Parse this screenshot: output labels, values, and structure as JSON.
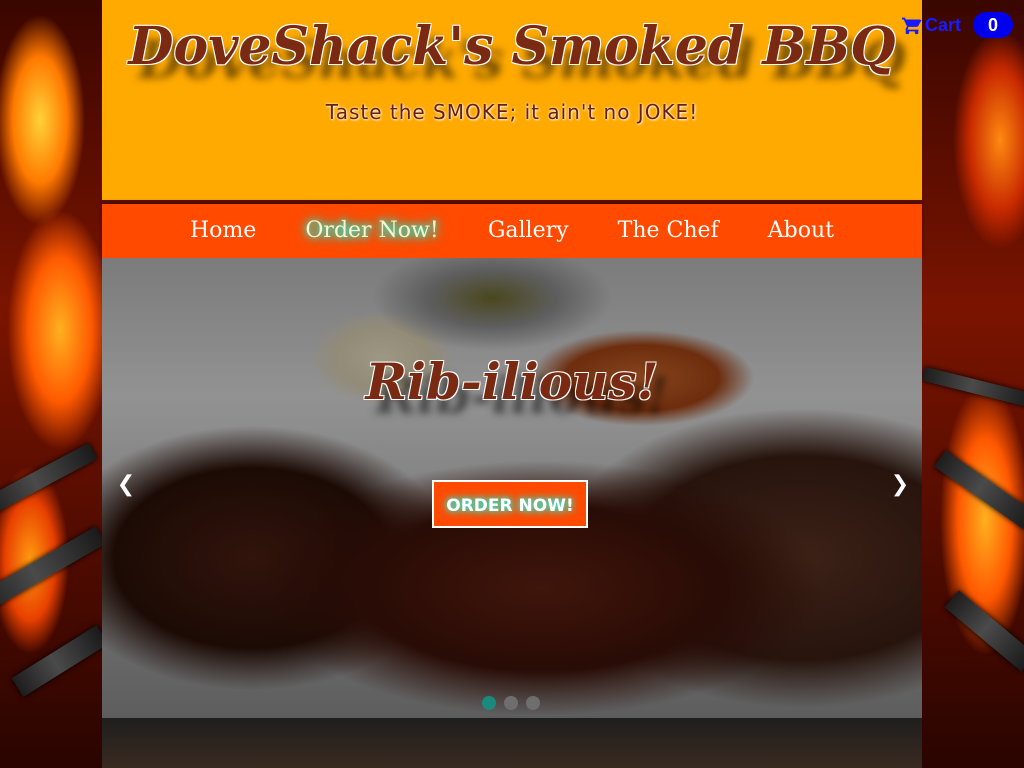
{
  "header": {
    "title": "DoveShack's Smoked BBQ",
    "tagline": "Taste the SMOKE; it ain't no JOKE!"
  },
  "nav": {
    "items": [
      {
        "label": "Home"
      },
      {
        "label": "Order Now!",
        "active": true
      },
      {
        "label": "Gallery"
      },
      {
        "label": "The Chef"
      },
      {
        "label": "About"
      }
    ]
  },
  "hero": {
    "heading": "Rib-ilious!",
    "cta_label": "ORDER NOW!",
    "prev_arrow": "❮",
    "next_arrow": "❯",
    "slide_count": 3,
    "active_slide": 1
  },
  "cart": {
    "label": "Cart",
    "count": "0",
    "icon": "shopping-cart-icon"
  },
  "colors": {
    "header_bg": "#ffaa00",
    "nav_bg": "#ff4a00",
    "title_text": "#7a2a12",
    "nav_glow": "#19f5d9",
    "cart_blue": "#0000ee"
  }
}
